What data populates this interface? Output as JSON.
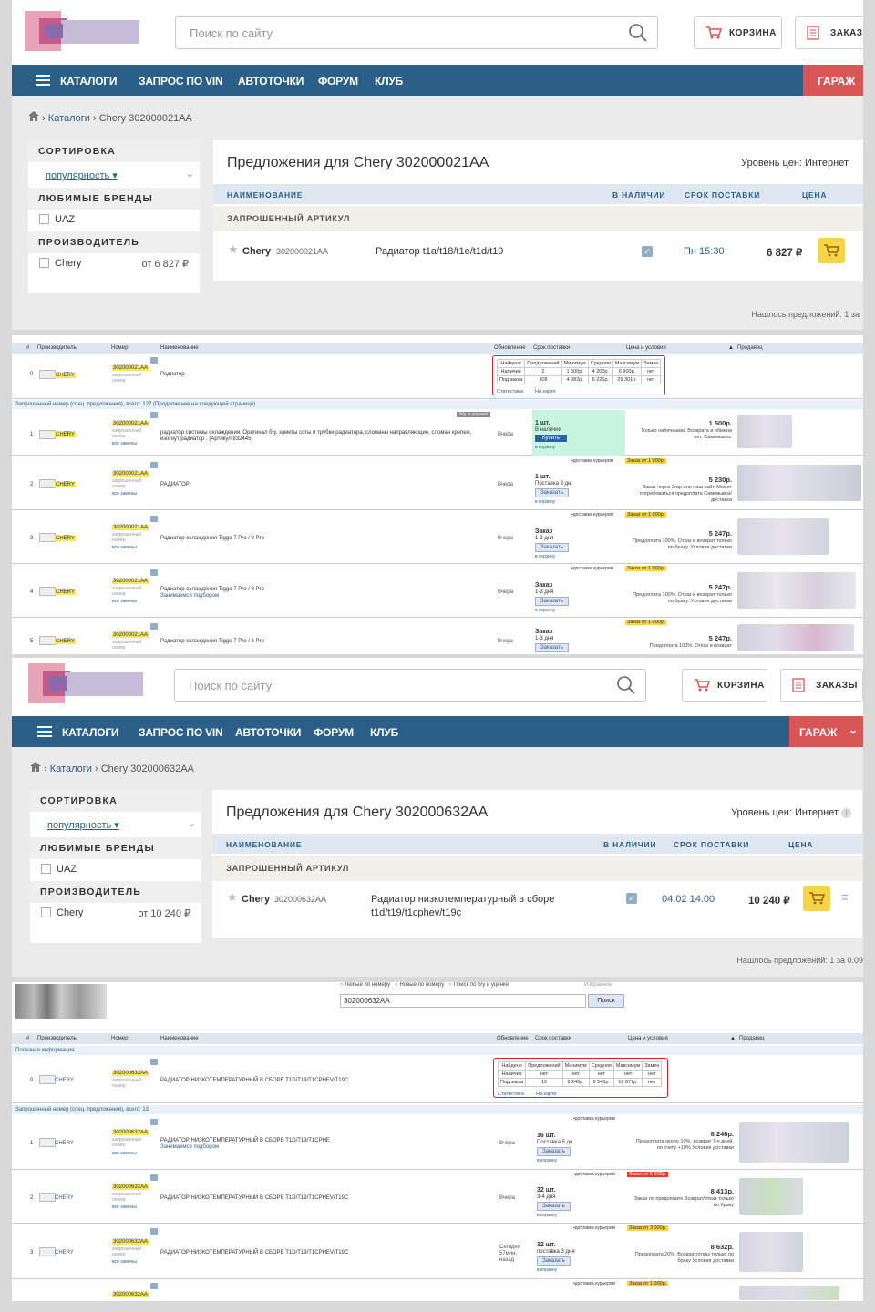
{
  "s1": {
    "search_placeholder": "Поиск по сайту",
    "cart_label": "КОРЗИНА",
    "orders_label": "ЗАКАЗЫ",
    "nav": [
      "КАТАЛОГИ",
      "ЗАПРОС ПО VIN",
      "АВТОТОЧКИ",
      "ФОРУМ",
      "КЛУБ"
    ],
    "garage": "ГАРАЖ",
    "crumb_catalogs": "Каталоги",
    "crumb_current": "Chery 302000021AA",
    "sort_title": "СОРТИРОВКА",
    "sort_value": "популярность ▾",
    "brands_title": "ЛЮБИМЫЕ БРЕНДЫ",
    "brand_uaz": "UAZ",
    "maker_title": "ПРОИЗВОДИТЕЛЬ",
    "maker_name": "Chery",
    "maker_price": "от 6 827 ₽",
    "title": "Предложения для  Chery 302000021AA",
    "price_level": "Уровень цен: Интернет",
    "th_name": "НАИМЕНОВАНИЕ",
    "th_stock": "В НАЛИЧИИ",
    "th_delivery": "СРОК ПОСТАВКИ",
    "th_price": "ЦЕНА",
    "requested": "ЗАПРОШЕННЫЙ АРТИКУЛ",
    "row_brand": "Chery",
    "row_article": "302000021AA",
    "row_desc": "Радиатор t1a/t18/t1e/t1d/t19",
    "row_delivery": "Пн 15:30",
    "row_price": "6 827 ₽",
    "found": "Нашлось предложений: 1 за"
  },
  "s2": {
    "head": [
      "#",
      "Производитель",
      "Номер",
      "Наименование",
      "Обновление",
      "Срок поставки",
      "Цена и условия",
      "▲",
      "Продавец"
    ],
    "top_row": {
      "num": "0",
      "brand": "CHERY",
      "pn": "302000021AA",
      "pn_sub": "запрошенный номер",
      "name": "Радиатор"
    },
    "stat_head": [
      "Найдено",
      "Предложений",
      "Минимум",
      "Средняя",
      "Максимум",
      "Замен"
    ],
    "stat_rows": [
      [
        "Наличие",
        "2",
        "1 500р.",
        "4 200р.",
        "6 900р.",
        "нет"
      ],
      [
        "Под заказ",
        "308",
        "4 082р.",
        "6 221р.",
        "29 301р.",
        "нет"
      ]
    ],
    "stat_link": "Статистика",
    "map_link": "На карте",
    "group": "Запрошенный номер (спец. предложения), всего: 127   (Продолжение на следующей странице)",
    "used_badge": "б/у и уценка",
    "rows": [
      {
        "num": "1",
        "brand": "CHERY",
        "pn": "302000021AA",
        "pn_sub": "запрошенный номер",
        "pn_link": "все замены",
        "name": "радиатор системы охлаждения. Оригинал б.у. заметы соты и трубки радиатора, сломаны направляющие, сломан крепеж, изогнут радиатор . (Артикул 832445)",
        "upd": "Вчера",
        "qty": "1 шт.",
        "qty_sub": "В наличии",
        "btn": "Купить",
        "basket": "в корзину",
        "courier": "",
        "min_order": "",
        "price": "1 500р.",
        "cond": "Только наличными. Возврата и обмена нет. Самовывоз."
      },
      {
        "num": "2",
        "brand": "CHERY",
        "pn": "302000021AA",
        "pn_sub": "запрошенный номер",
        "pn_link": "все замены",
        "name": "РАДИАТОР",
        "upd": "Вчера",
        "qty": "1 шт.",
        "qty_sub": "Поставка 3 дн.",
        "btn": "Заказать",
        "basket": "в корзину",
        "courier": "•доставка курьером",
        "min_order": "Заказ от 1 000р.",
        "price": "5 230р.",
        "cond": "Заказ через 2гар или наш сайт. Может потребоваться предоплата Самовывоз/доставка"
      },
      {
        "num": "3",
        "brand": "CHERY",
        "pn": "302000021AA",
        "pn_sub": "запрошенный номер",
        "pn_link": "все замены",
        "name": "Радиатор охлаждения Tiggo 7 Pro / 8 Pro",
        "upd": "Вчера",
        "qty": "Заказ",
        "qty_sub": "1-3 дня",
        "btn": "Заказать",
        "basket": "в корзину",
        "courier": "•доставка курьером",
        "min_order": "Заказ от 1 000р.",
        "price": "5 247р.",
        "cond": "Предоплата 100%. Отказ и возврат только по браку. Условия доставки"
      },
      {
        "num": "4",
        "brand": "CHERY",
        "pn": "302000021AA",
        "pn_sub": "запрошенный номер",
        "pn_link": "все замены",
        "name": "Радиатор охлаждения Tiggo 7 Pro / 8 Pro",
        "name_sub": "Занимаемся подбором",
        "upd": "Вчера",
        "qty": "Заказ",
        "qty_sub": "1-3 дня",
        "btn": "Заказать",
        "basket": "в корзину",
        "courier": "•доставка курьером",
        "min_order": "Заказ от 1 000р.",
        "price": "5 247р.",
        "cond": "Предоплата 100%. Отказ и возврат только по браку. Условия доставки"
      },
      {
        "num": "5",
        "brand": "CHERY",
        "pn": "302000021AA",
        "pn_sub": "запрошенный номер",
        "pn_link": "все замены",
        "name": "Радиатор охлаждения Tiggo 7 Pro / 8 Pro",
        "upd": "Вчера",
        "qty": "Заказ",
        "qty_sub": "1-3 дня",
        "btn": "Заказать",
        "basket": "",
        "courier": "",
        "min_order": "Заказ от 1 000р.",
        "price": "5 247р.",
        "cond": "Предоплата 100%. Отказ и возврат"
      }
    ]
  },
  "s3": {
    "search_placeholder": "Поиск по сайту",
    "cart_label": "КОРЗИНА",
    "orders_label": "ЗАКАЗЫ",
    "nav": [
      "КАТАЛОГИ",
      "ЗАПРОС ПО VIN",
      "АВТОТОЧКИ",
      "ФОРУМ",
      "КЛУБ"
    ],
    "garage": "ГАРАЖ",
    "crumb_catalogs": "Каталоги",
    "crumb_current": "Chery 302000632AA",
    "sort_title": "СОРТИРОВКА",
    "sort_value": "популярность ▾",
    "brands_title": "ЛЮБИМЫЕ БРЕНДЫ",
    "brand_uaz": "UAZ",
    "maker_title": "ПРОИЗВОДИТЕЛЬ",
    "maker_name": "Chery",
    "maker_price": "от 10 240 ₽",
    "title": "Предложения для  Chery 302000632AA",
    "price_level": "Уровень цен: Интернет",
    "th_name": "НАИМЕНОВАНИЕ",
    "th_stock": "В НАЛИЧИИ",
    "th_delivery": "СРОК ПОСТАВКИ",
    "th_price": "ЦЕНА",
    "requested": "ЗАПРОШЕННЫЙ АРТИКУЛ",
    "row_brand": "Chery",
    "row_article": "302000632AA",
    "row_desc1": "Радиатор низкотемпературный в сборе",
    "row_desc2": "t1d/t19/t1cphev/t19c",
    "row_delivery": "04.02 14:00",
    "row_price": "10 240 ₽",
    "found": "Нашлось предложений: 1 за 0.09"
  },
  "s4": {
    "radio": [
      "Любые по номеру",
      "Новые по номеру",
      "Поиск по б/у и уценке"
    ],
    "fav": "Избранное",
    "search_value": "302000632AA",
    "search_btn": "Поиск",
    "head": [
      "#",
      "Производитель",
      "Номер",
      "Наименование",
      "Обновление",
      "Срок поставки",
      "Цена и условия",
      "▲",
      "Продавец"
    ],
    "useful": "Полезная информация",
    "top_row": {
      "num": "0",
      "brand": "CHERY",
      "pn": "302000632AA",
      "pn_sub": "запрошенный номер",
      "name": "РАДИАТОР НИЗКОТЕМПЕРАТУРНЫЙ В СБОРЕ T1D/T19/T1CPHEV/T19C"
    },
    "stat_head": [
      "Найдено",
      "Предложений",
      "Минимум",
      "Средняя",
      "Максимум",
      "Замен"
    ],
    "stat_rows": [
      [
        "Наличие",
        "нет",
        "нет",
        "нет",
        "нет",
        "нет"
      ],
      [
        "Под заказ",
        "19",
        "8 246р.",
        "9 540р.",
        "10 877р.",
        "нет"
      ]
    ],
    "stat_link": "Статистика",
    "map_link": "На карте",
    "group": "Запрошенный номер (спец. предложения), всего: 13",
    "rows": [
      {
        "num": "1",
        "brand": "CHERY",
        "pn": "302000632AA",
        "pn_sub": "запрошенный номер",
        "pn_link": "все замены",
        "name": "РАДИАТОР НИЗКОТЕМПЕРАТУРНЫЙ В СБОРЕ T1D/T19/T1CPHE",
        "name_sub": "Занимаемся подбором",
        "upd": "Вчера",
        "qty": "16 шт.",
        "qty_sub": "Поставка 5 дн.",
        "btn": "Заказать",
        "basket": "в корзину",
        "courier": "•доставка курьером",
        "min_order": "",
        "price": "8 246р.",
        "cond": "Предоплата около 10%, возврат 7-ч дней, по счету +10% Условия доставки"
      },
      {
        "num": "2",
        "brand": "CHERY",
        "pn": "302000632AA",
        "pn_sub": "запрошенный номер",
        "pn_link": "все замены",
        "name": "РАДИАТОР НИЗКОТЕМПЕРАТУРНЫЙ В СБОРЕ T1D/T19/T1CPHEV/T19C",
        "upd": "Вчера",
        "qty": "32 шт.",
        "qty_sub": "3-4 дня",
        "btn": "Заказать",
        "basket": "в корзину",
        "courier": "•доставка курьером",
        "min_order": "Заказ от 5 000р.",
        "price": "8 413р.",
        "cond": "Заказ по предоплате.Возврат/отказ только по браку"
      },
      {
        "num": "3",
        "brand": "CHERY",
        "pn": "302000632AA",
        "pn_sub": "запрошенный номер",
        "pn_link": "все замены",
        "name": "РАДИАТОР НИЗКОТЕМПЕРАТУРНЫЙ В СБОРЕ T1D/T19/T1CPHEV/T19C",
        "upd": "Сегодня 57мин. назад",
        "qty": "32 шт.",
        "qty_sub": "поставка 3 дня",
        "btn": "Заказать",
        "basket": "в корзину",
        "courier": "•доставка курьером",
        "min_order": "Заказ от 3 000р.",
        "price": "8 632р.",
        "cond": "Предоплата 20%, Возврат/отказ только по браку Условия доставки"
      },
      {
        "num": "",
        "brand": "",
        "pn": "302000632AA",
        "pn_sub": "",
        "pn_link": "",
        "name": "",
        "upd": "",
        "qty": "",
        "qty_sub": "",
        "btn": "",
        "basket": "",
        "courier": "•доставка курьером",
        "min_order": "Заказ от 1 000р.",
        "price": "",
        "cond": ""
      }
    ]
  }
}
